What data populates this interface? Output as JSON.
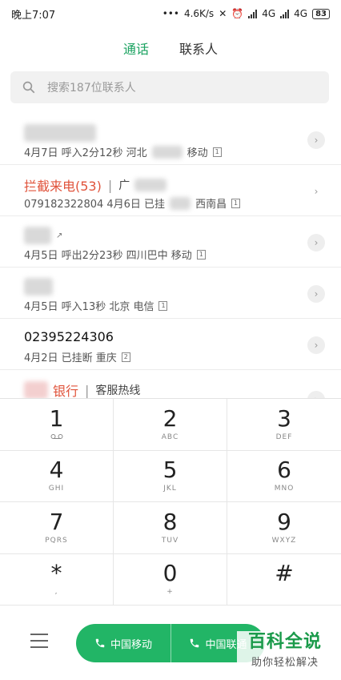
{
  "status_bar": {
    "time": "晚上7:07",
    "dots": "•••",
    "speed": "4.6K/s",
    "net1": "4G",
    "net2": "4G",
    "battery": "83"
  },
  "tabs": [
    {
      "label": "通话",
      "active": true
    },
    {
      "label": "联系人",
      "active": false
    }
  ],
  "search": {
    "placeholder": "搜索187位联系人"
  },
  "call_log": [
    {
      "meta": "4月7日  呼入2分12秒  河北",
      "carrier": "移动",
      "sim": "1"
    },
    {
      "name": "拦截来电(53)",
      "name_suffix": "广",
      "meta": "079182322804  4月6日  已挂",
      "carrier": "西南昌",
      "sim": "1"
    },
    {
      "meta": "4月5日  呼出2分23秒  四川巴中  移动",
      "sim": "1"
    },
    {
      "meta": "4月5日  呼入13秒  北京  电信",
      "sim": "1"
    },
    {
      "name": "02395224306",
      "meta": "4月2日  已挂断  重庆",
      "sim": "2"
    },
    {
      "name": "银行",
      "subtitle": "客服热线"
    }
  ],
  "dialpad": [
    {
      "digit": "1",
      "letters": ""
    },
    {
      "digit": "2",
      "letters": "ABC"
    },
    {
      "digit": "3",
      "letters": "DEF"
    },
    {
      "digit": "4",
      "letters": "GHI"
    },
    {
      "digit": "5",
      "letters": "JKL"
    },
    {
      "digit": "6",
      "letters": "MNO"
    },
    {
      "digit": "7",
      "letters": "PQRS"
    },
    {
      "digit": "8",
      "letters": "TUV"
    },
    {
      "digit": "9",
      "letters": "WXYZ"
    },
    {
      "digit": "*",
      "letters": ","
    },
    {
      "digit": "0",
      "letters": "+"
    },
    {
      "digit": "#",
      "letters": ""
    }
  ],
  "call_buttons": [
    {
      "label": "中国移动"
    },
    {
      "label": "中国联通"
    }
  ],
  "watermark": {
    "title": "百科全说",
    "subtitle": "助你轻松解决"
  },
  "colors": {
    "accent": "#1aa260",
    "call_green": "#22b566",
    "blocked_red": "#e0533b"
  }
}
